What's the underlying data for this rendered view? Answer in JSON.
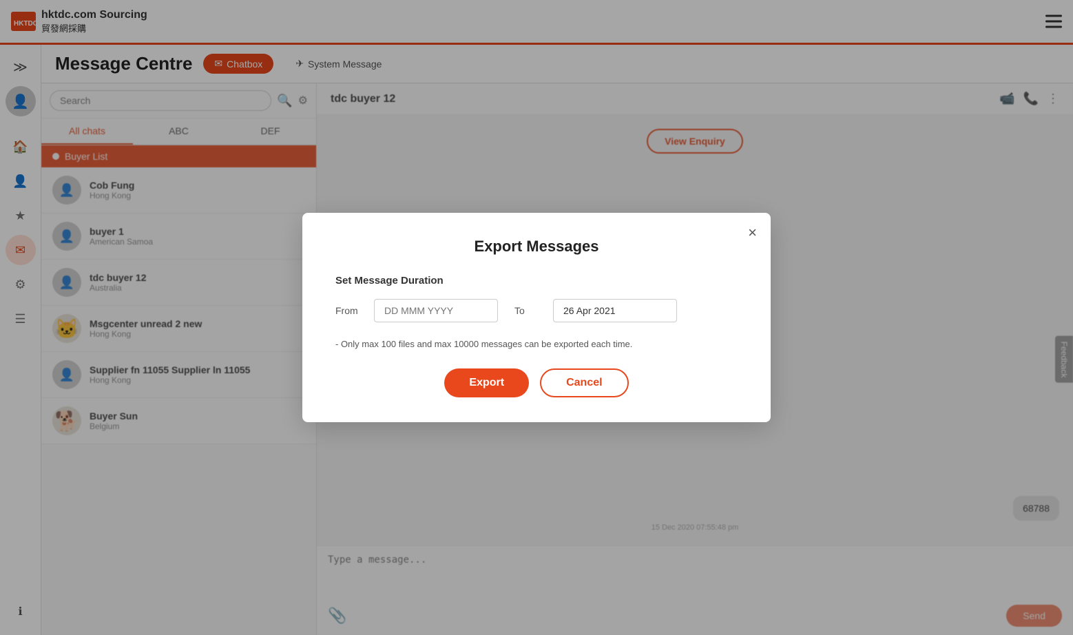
{
  "header": {
    "logo_icon_text": "HKTDC",
    "logo_main": "hktdc.com Sourcing",
    "logo_sub": "貿發網採購",
    "hamburger_label": "Menu"
  },
  "page": {
    "title": "Message Centre",
    "tabs": [
      {
        "id": "chatbox",
        "label": "Chatbox",
        "active": true
      },
      {
        "id": "system-message",
        "label": "System Message",
        "active": false
      }
    ]
  },
  "search": {
    "placeholder": "Search",
    "value": ""
  },
  "chat_tabs": [
    {
      "id": "all-chats",
      "label": "All chats",
      "active": true
    },
    {
      "id": "abc",
      "label": "ABC",
      "active": false
    },
    {
      "id": "def",
      "label": "DEF",
      "active": false
    }
  ],
  "buyer_list": {
    "header": "Buyer List",
    "items": [
      {
        "name": "Cob Fung",
        "location": "Hong Kong"
      },
      {
        "name": "buyer 1",
        "location": "American Samoa"
      },
      {
        "name": "tdc buyer 12",
        "location": "Australia"
      },
      {
        "name": "Msgcenter unread 2 new",
        "location": "Hong Kong"
      },
      {
        "name": "Supplier fn 11055 Supplier ln 11055",
        "location": "Hong Kong"
      },
      {
        "name": "Buyer Sun",
        "location": "Belgium"
      }
    ]
  },
  "message_panel": {
    "contact_name": "tdc buyer 12",
    "view_enquiry_label": "View Enquiry",
    "message_bubble_text": "68788",
    "message_timestamp": "15 Dec 2020 07:55:48 pm",
    "input_placeholder": "Type a message...",
    "send_label": "Send",
    "attach_icon": "📎"
  },
  "feedback": {
    "label": "Feedback"
  },
  "sidebar_icons": [
    {
      "id": "expand",
      "icon": "≫",
      "label": "expand-icon"
    },
    {
      "id": "avatar",
      "icon": "👤",
      "label": "user-avatar"
    },
    {
      "id": "home",
      "icon": "🏠",
      "label": "home-icon"
    },
    {
      "id": "user",
      "icon": "👤",
      "label": "user-icon"
    },
    {
      "id": "star",
      "icon": "★",
      "label": "star-icon"
    },
    {
      "id": "chat",
      "icon": "💬",
      "label": "chat-icon"
    },
    {
      "id": "settings",
      "icon": "⚙",
      "label": "settings-icon"
    },
    {
      "id": "list",
      "icon": "☰",
      "label": "list-icon"
    },
    {
      "id": "info",
      "icon": "ℹ",
      "label": "info-icon"
    }
  ],
  "modal": {
    "title": "Export Messages",
    "section_label": "Set Message Duration",
    "from_label": "From",
    "to_label": "To",
    "from_placeholder": "DD MMM YYYY",
    "to_value": "26 Apr 2021",
    "note": "- Only max 100 files and max 10000 messages can be exported each time.",
    "export_label": "Export",
    "cancel_label": "Cancel",
    "close_label": "×"
  }
}
